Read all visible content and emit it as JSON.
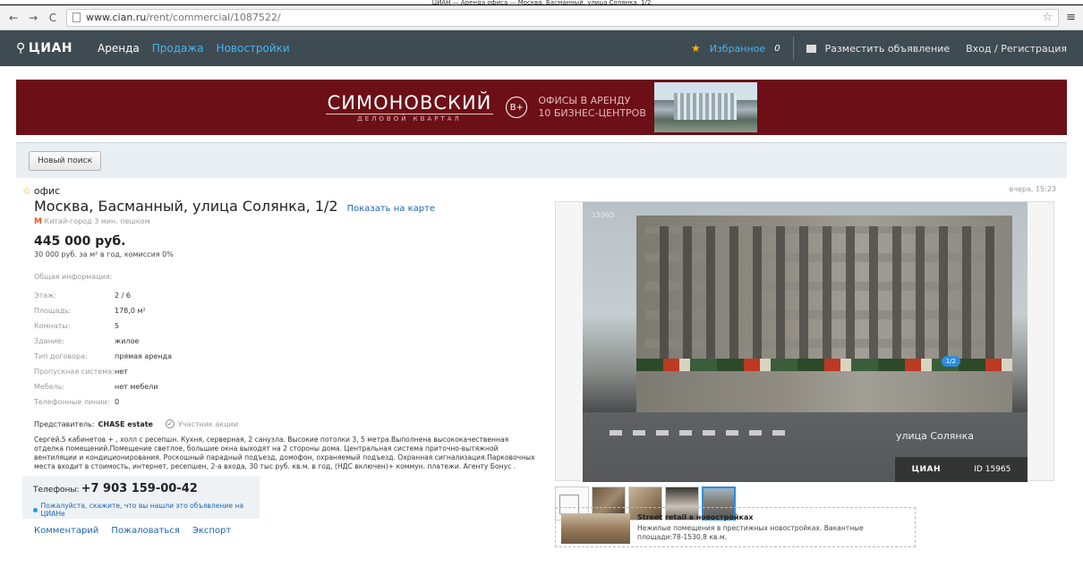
{
  "window": {
    "title_strip": "ЦИАН — Аренда офиса — Москва, Басманный, улица Солянка, 1/2"
  },
  "browser": {
    "url_host": "www.cian.ru",
    "url_path": "/rent/commercial/1087522/"
  },
  "topnav": {
    "logo": "ЦИАН",
    "items": [
      {
        "label": "Аренда"
      },
      {
        "label": "Продажа"
      },
      {
        "label": "Новостройки"
      }
    ],
    "favorites_label": "Избранное",
    "favorites_count": "0",
    "place_ad": "Разместить объявление",
    "login": "Вход / Регистрация"
  },
  "banner": {
    "brand": "СИМОНОВСКИЙ",
    "brand_sub": "ДЕЛОВОЙ КВАРТАЛ",
    "badge": "B+",
    "line1": "ОФИСЫ В АРЕНДУ",
    "line2": "10 БИЗНЕС-ЦЕНТРОВ"
  },
  "search": {
    "new_search": "Новый поиск"
  },
  "listing": {
    "type": "офис",
    "address": "Москва, Басманный, улица Солянка, 1/2",
    "map_link": "Показать на карте",
    "metro": "Китай-город 3 мин. пешком",
    "price": "445 000 руб.",
    "price_sub": "30 000 руб. за м² в год, комиссия 0%",
    "date": "вчера, 15:23",
    "info_head": "Общая информация:",
    "info": [
      {
        "k": "Этаж:",
        "v": "2 / 6"
      },
      {
        "k": "Площадь:",
        "v": "178,0 м²"
      },
      {
        "k": "Комнаты:",
        "v": "5"
      },
      {
        "k": "Здание:",
        "v": "жилое"
      },
      {
        "k": "Тип договора:",
        "v": "прямая аренда"
      },
      {
        "k": "Пропускная система:",
        "v": "нет"
      },
      {
        "k": "Мебель:",
        "v": "нет мебели"
      },
      {
        "k": "Телефонные линии:",
        "v": "0"
      }
    ],
    "rep_label": "Представитель:",
    "rep_company": "CHASE estate",
    "rep_member": "Участник акции",
    "description": "Сергей.5 кабинетов + , холл с ресепшн. Кухня, серверная, 2 санузла. Высокие потолки 3, 5 метра.Выполнена высококачественная отделка помещений.Помещение светлое, большие окна выходят на 2 стороны дома. Центральная система приточно-вытяжной вентиляции и кондиционирования. Роскошный парадный подъезд, домофон, охраняемый подъезд. Охранная сигнализация.Парковочных места входит в стоимость, интернет, ресепшен, 2-а входа, 30 тыс руб. кв.м. в год, (НДС включен)+ коммун. платежи. Агенту Бонус .",
    "phone_label": "Телефоны:",
    "phone": "+7 903 159-00-42",
    "phone_note": "Пожалуйста, скажите, что вы нашли это объявление на ЦИАНе",
    "links": [
      "Комментарий",
      "Пожаловаться",
      "Экспорт"
    ]
  },
  "photo": {
    "id_top": "15965",
    "street": "улица Солянка",
    "counter": "1/2",
    "wm_logo": "ЦИАН",
    "wm_id": "ID 15965"
  },
  "promo": {
    "title": "Street retail в новостройках",
    "text": "Нежилые помещения в престижных новостройках. Вакантные площади:78-1530,8 кв.м."
  }
}
